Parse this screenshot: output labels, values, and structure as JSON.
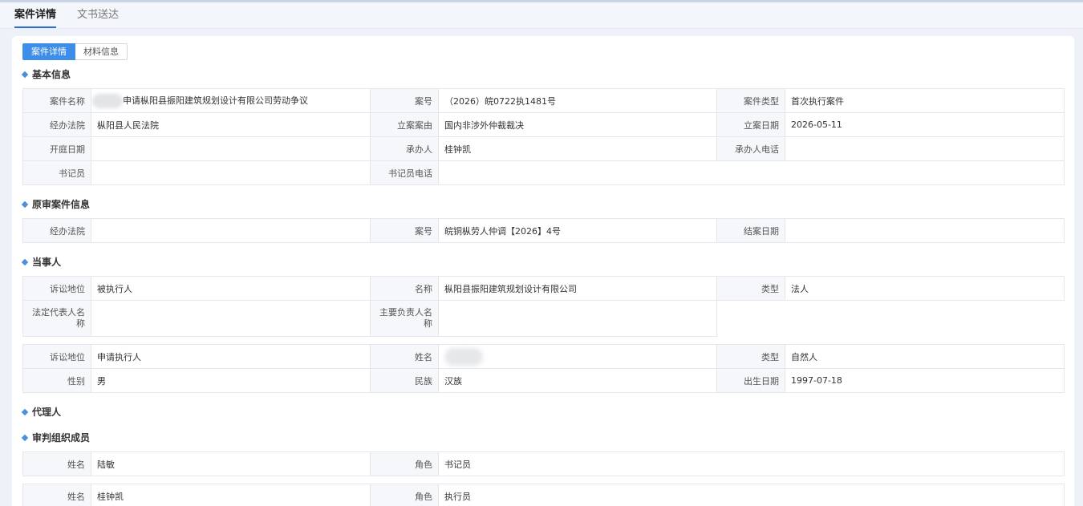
{
  "top_tabs": {
    "case_detail": "案件详情",
    "doc_delivery": "文书送达"
  },
  "sub_tabs": {
    "case_detail": "案件详情",
    "materials": "材料信息"
  },
  "sections": {
    "basic": "基本信息",
    "original": "原审案件信息",
    "parties": "当事人",
    "agent": "代理人",
    "trial_members": "审判组织成员"
  },
  "basic": {
    "case_name_label": "案件名称",
    "case_name": "申请枞阳县振阳建筑规划设计有限公司劳动争议",
    "case_no_label": "案号",
    "case_no": "（2026）皖0722执1481号",
    "case_type_label": "案件类型",
    "case_type": "首次执行案件",
    "court_label": "经办法院",
    "court": "枞阳县人民法院",
    "filing_cause_label": "立案案由",
    "filing_cause": "国内非涉外仲裁裁决",
    "filing_date_label": "立案日期",
    "filing_date": "2026-05-11",
    "hearing_date_label": "开庭日期",
    "hearing_date": "",
    "handler_label": "承办人",
    "handler": "桂钟凯",
    "handler_phone_label": "承办人电话",
    "handler_phone": "",
    "clerk_label": "书记员",
    "clerk": "",
    "clerk_phone_label": "书记员电话",
    "clerk_phone": ""
  },
  "original": {
    "court_label": "经办法院",
    "court": "",
    "case_no_label": "案号",
    "case_no": "皖铜枞劳人仲调【2026】4号",
    "close_date_label": "结案日期",
    "close_date": ""
  },
  "party1": {
    "status_label": "诉讼地位",
    "status": "被执行人",
    "name_label": "名称",
    "name": "枞阳县振阳建筑规划设计有限公司",
    "type_label": "类型",
    "type": "法人",
    "legal_rep_label": "法定代表人名称",
    "legal_rep": "",
    "principal_label": "主要负责人名称",
    "principal": ""
  },
  "party2": {
    "status_label": "诉讼地位",
    "status": "申请执行人",
    "name_label": "姓名",
    "name": "",
    "type_label": "类型",
    "type": "自然人",
    "gender_label": "性别",
    "gender": "男",
    "ethnicity_label": "民族",
    "ethnicity": "汉族",
    "birth_label": "出生日期",
    "birth": "1997-07-18"
  },
  "members": [
    {
      "name_label": "姓名",
      "name": "陆敏",
      "role_label": "角色",
      "role": "书记员"
    },
    {
      "name_label": "姓名",
      "name": "桂钟凯",
      "role_label": "角色",
      "role": "执行员"
    }
  ]
}
